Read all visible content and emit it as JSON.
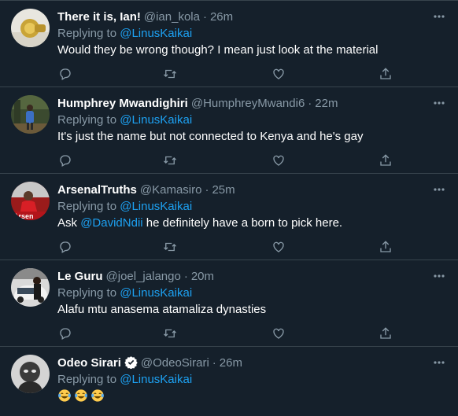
{
  "tweets": [
    {
      "name": "There it is, Ian!",
      "handle": "@ian_kola",
      "dot": "·",
      "time": "26m",
      "replying_prefix": "Replying to",
      "replying_to": "@LinusKaikai",
      "text": "Would they be wrong though? I mean just look at the material",
      "avatar": "avatar-ian",
      "verified": false
    },
    {
      "name": "Humphrey Mwandighiri",
      "handle": "@HumphreyMwandi6",
      "dot": "·",
      "time": "22m",
      "replying_prefix": "Replying to",
      "replying_to": "@LinusKaikai",
      "text": "It's just the name but not connected to Kenya and he's gay",
      "avatar": "avatar-humphrey",
      "verified": false
    },
    {
      "name": "ArsenalTruths",
      "handle": "@Kamasiro",
      "dot": "·",
      "time": "25m",
      "replying_prefix": "Replying to",
      "replying_to": "@LinusKaikai",
      "text_prefix": "Ask ",
      "text_mention": "@DavidNdii",
      "text_suffix": " he definitely have a born to pick here.",
      "avatar": "avatar-arsenal",
      "verified": false
    },
    {
      "name": "Le Guru",
      "handle": "@joel_jalango",
      "dot": "·",
      "time": "20m",
      "replying_prefix": "Replying to",
      "replying_to": "@LinusKaikai",
      "text": "Alafu mtu anasema atamaliza dynasties",
      "avatar": "avatar-leguru",
      "verified": false
    },
    {
      "name": "Odeo Sirari",
      "handle": "@OdeoSirari",
      "dot": "·",
      "time": "26m",
      "replying_prefix": "Replying to",
      "replying_to": "@LinusKaikai",
      "text": "",
      "emojis": [
        "face-with-tears-of-joy",
        "face-with-tears-of-joy",
        "face-with-tears-of-joy"
      ],
      "avatar": "avatar-odeo",
      "verified": true
    }
  ],
  "icons": {
    "reply": "reply-icon",
    "retweet": "retweet-icon",
    "like": "like-icon",
    "share": "share-icon",
    "more": "more-icon"
  },
  "colors": {
    "background": "#15202b",
    "border": "#38444d",
    "secondary_text": "#8899a6",
    "link": "#1da1f2",
    "primary_text": "#ffffff"
  }
}
